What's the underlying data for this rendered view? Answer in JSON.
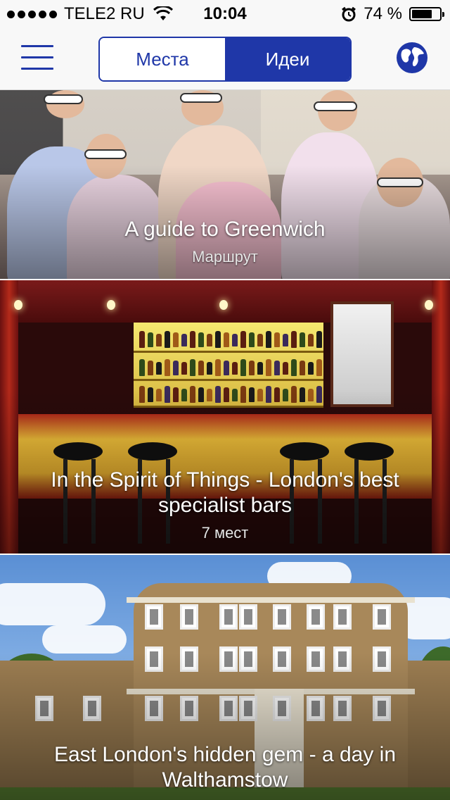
{
  "status_bar": {
    "carrier": "TELE2 RU",
    "time": "10:04",
    "battery_percent": "74 %",
    "battery_level": 0.74
  },
  "nav": {
    "tabs": [
      {
        "label": "Места",
        "active": false
      },
      {
        "label": "Идеи",
        "active": true
      }
    ],
    "accent_color": "#1f37a8"
  },
  "cards": [
    {
      "title": "A guide to Greenwich",
      "subtitle": "Маршрут"
    },
    {
      "title": "In the Spirit of Things - London's best specialist bars",
      "subtitle": "7 мест"
    },
    {
      "title": "East London's hidden gem - a day in Walthamstow",
      "subtitle": ""
    }
  ]
}
